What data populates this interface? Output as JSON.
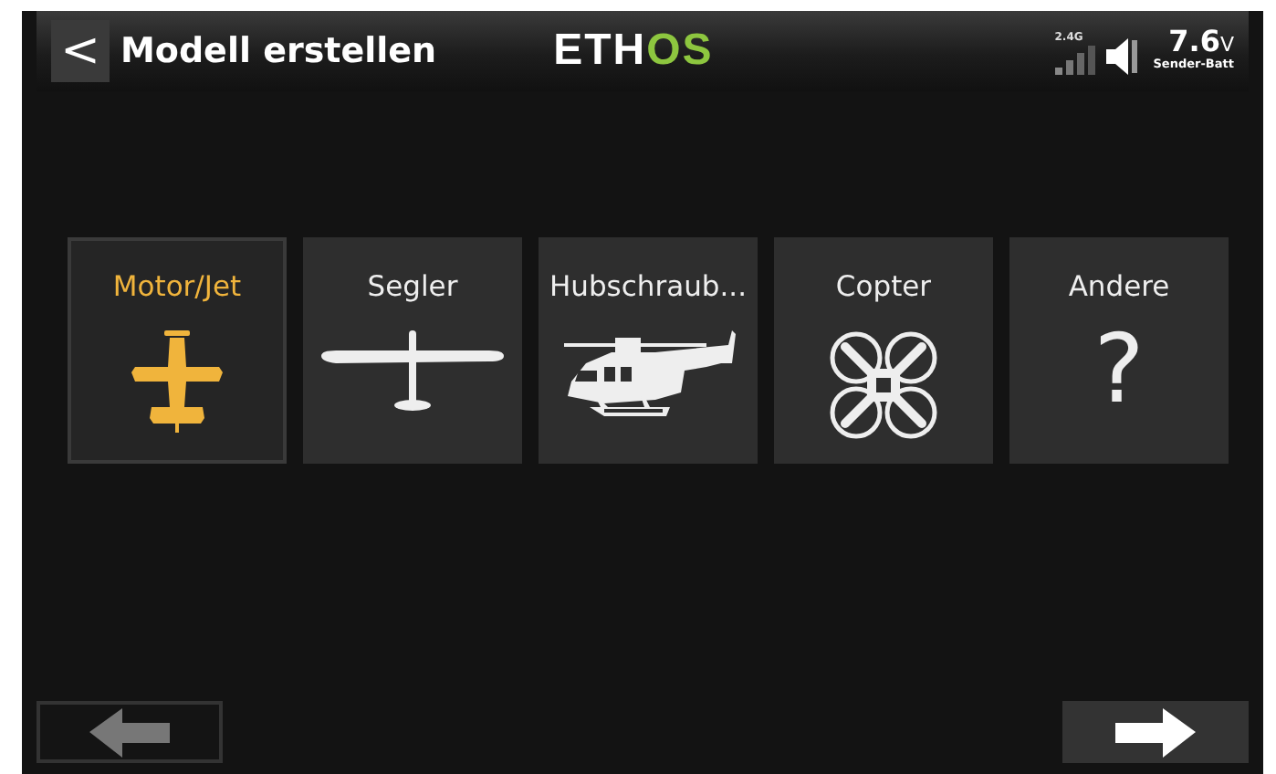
{
  "header": {
    "back_glyph": "<",
    "title": "Modell erstellen",
    "logo": [
      {
        "text": "ETH",
        "color": "#ffffff"
      },
      {
        "text": "OS",
        "color": "#8dc63f"
      }
    ],
    "rf_label": "2.4G",
    "battery_value": "7.6",
    "battery_unit": "V",
    "battery_label": "Sender-Batt"
  },
  "model_types": [
    {
      "label": "Motor/Jet",
      "kind": "plane",
      "selected": true
    },
    {
      "label": "Segler",
      "kind": "glider",
      "selected": false
    },
    {
      "label": "Hubschraub...",
      "kind": "heli",
      "selected": false
    },
    {
      "label": "Copter",
      "kind": "copter",
      "selected": false
    },
    {
      "label": "Andere",
      "kind": "other",
      "glyph": "?",
      "selected": false
    }
  ],
  "nav_buttons": [
    {
      "kind": "prev",
      "disabled": true
    },
    {
      "kind": "next",
      "disabled": false
    }
  ]
}
